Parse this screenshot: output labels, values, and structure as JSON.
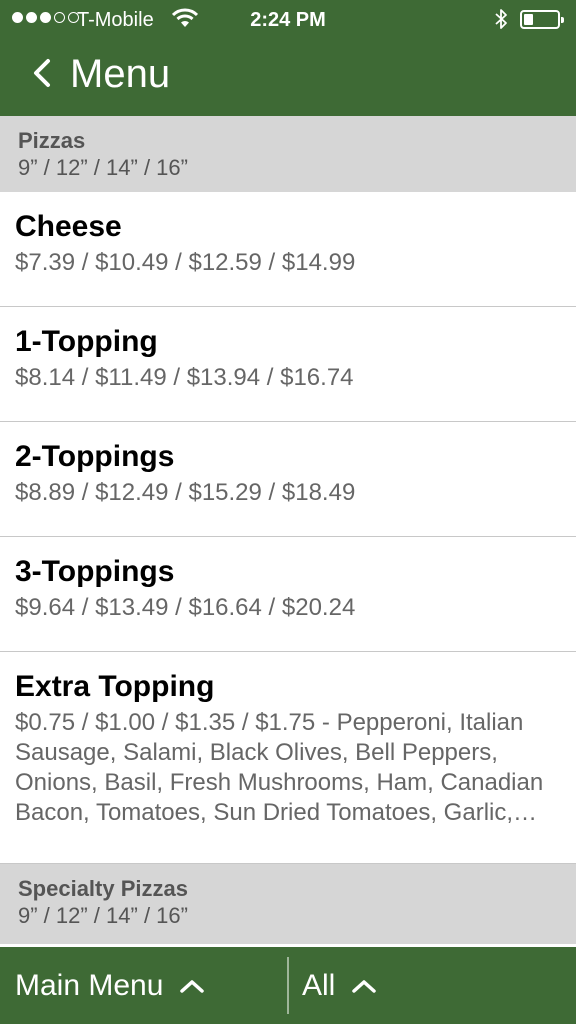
{
  "status_bar": {
    "carrier": "T-Mobile",
    "time": "2:24 PM",
    "signal_bars_filled": 3,
    "signal_bars_total": 5
  },
  "nav": {
    "back_icon": "chevron-left-icon",
    "title": "Menu"
  },
  "sections": [
    {
      "title": "Pizzas",
      "subtitle": "9” / 12” / 14” / 16”"
    },
    {
      "title": "Specialty Pizzas",
      "subtitle": "9” / 12” / 14” / 16”"
    }
  ],
  "items": [
    {
      "name": "Cheese",
      "price": "$7.39 / $10.49 / $12.59 / $14.99"
    },
    {
      "name": "1-Topping",
      "price": "$8.14 / $11.49 / $13.94 / $16.74"
    },
    {
      "name": "2-Toppings",
      "price": "$8.89 / $12.49 / $15.29 / $18.49"
    },
    {
      "name": "3-Toppings",
      "price": "$9.64 / $13.49 / $16.64 / $20.24"
    },
    {
      "name": "Extra Topping",
      "price": "$0.75 / $1.00 / $1.35 / $1.75 - Pepperoni, Italian Sausage, Salami, Black Olives, Bell Peppers, Onions, Basil, Fresh Mushrooms, Ham, Canadian Bacon, Tomatoes, Sun Dried Tomatoes, Garlic,…"
    }
  ],
  "tab_bar": {
    "main_menu": "Main Menu",
    "all": "All",
    "icon": "chevron-up-icon"
  },
  "colors": {
    "brand_green": "#3e6a35",
    "section_gray": "#d6d6d6"
  }
}
